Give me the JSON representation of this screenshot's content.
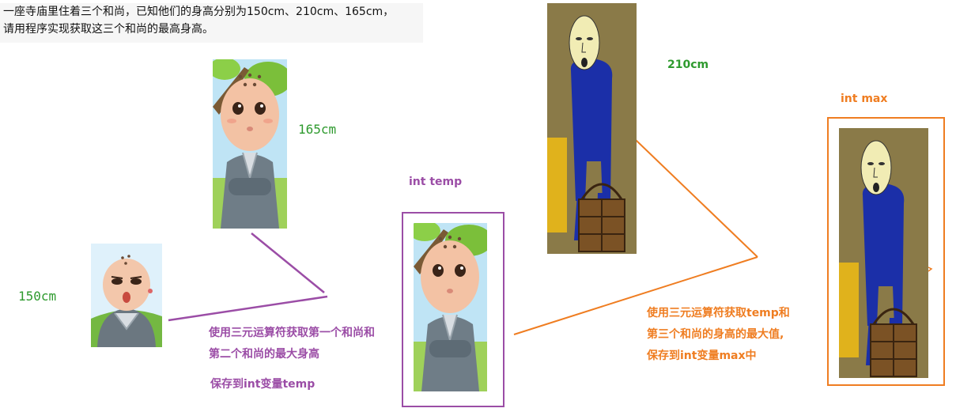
{
  "problem": {
    "line1": "一座寺庙里住着三个和尚，已知他们的身高分别为150cm、210cm、165cm，",
    "line2": "请用程序实现获取这三个和尚的最高身高。"
  },
  "heights": {
    "monk1": "150cm",
    "monk2": "210cm",
    "monk3": "165cm"
  },
  "variables": {
    "temp": "int temp",
    "max": "int max"
  },
  "steps": {
    "step1_line1": "使用三元运算符获取第一个和尚和",
    "step1_line2": "第二个和尚的最大身高",
    "step1_line3": "保存到int变量temp",
    "step2_line1": "使用三元运算符获取temp和",
    "step2_line2": "第三个和尚的身高的最大值,",
    "step2_line3": "保存到int变量max中"
  },
  "colors": {
    "height_label": "#2e9a2e",
    "step1_accent": "#9b4da6",
    "step2_accent": "#ef7d21"
  },
  "icons": [
    "short-monk-illustration",
    "medium-monk-illustration",
    "tall-monk-illustration"
  ]
}
